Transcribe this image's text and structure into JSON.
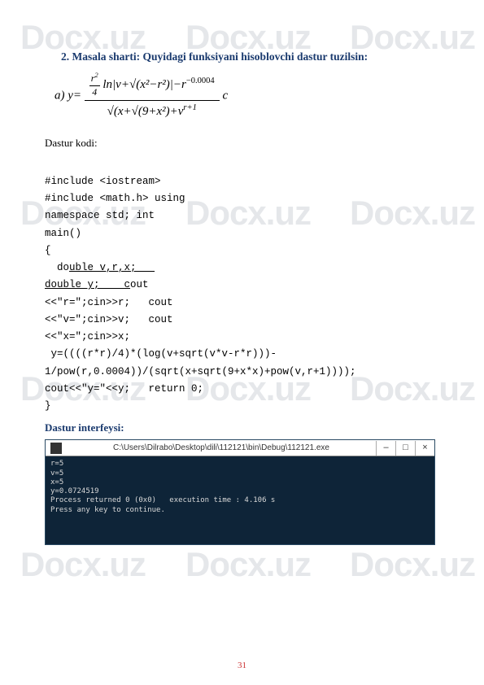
{
  "watermark": "Docx.uz",
  "title": "2. Masala sharti: Quyidagi funksiyani hisoblovchi dastur tuzilsin:",
  "formula_label": "a)  y=",
  "formula_num_part1": "r",
  "formula_num_part1_sup": "2",
  "formula_num_part1_den": "4",
  "formula_num_rest": "ln|v+√(x²−r²)|−r",
  "formula_num_exp": "−0.0004",
  "formula_den": "√(x+√(9+x²)+v",
  "formula_den_exp": "r+1",
  "formula_trail": "c",
  "subhead": "Dastur kodi:",
  "code": {
    "l1": "#include <iostream>",
    "l2": "#include <math.h> using",
    "l3": "namespace std; int",
    "l4": "main()",
    "l5": "{",
    "l6a": "  do",
    "l6b": "uble v,r,x;   ",
    "l7a": "dou",
    "l7b": "ble y;    c",
    "l7c": "out",
    "l8": "<<\"r=\";cin>>r;   cout",
    "l9": "<<\"v=\";cin>>v;   cout",
    "l10": "<<\"x=\";cin>>x;",
    "l11": " y=((((r*r)/4)*(log(v+sqrt(v*v-r*r)))-",
    "l12": "1/pow(r,0.0004))/(sqrt(x+sqrt(9+x*x)+pow(v,r+1))));",
    "l13": "cout<<\"y=\"<<y;   return 0;",
    "l14": "}"
  },
  "interface_title": "Dastur interfeysi:",
  "console": {
    "title": "C:\\Users\\Dilrabo\\Desktop\\dili\\112121\\bin\\Debug\\112121.exe",
    "body": "r=5\nv=5\nx=5\ny=0.0724519\nProcess returned 0 (0x0)   execution time : 4.106 s\nPress any key to continue."
  },
  "page_number": "31"
}
